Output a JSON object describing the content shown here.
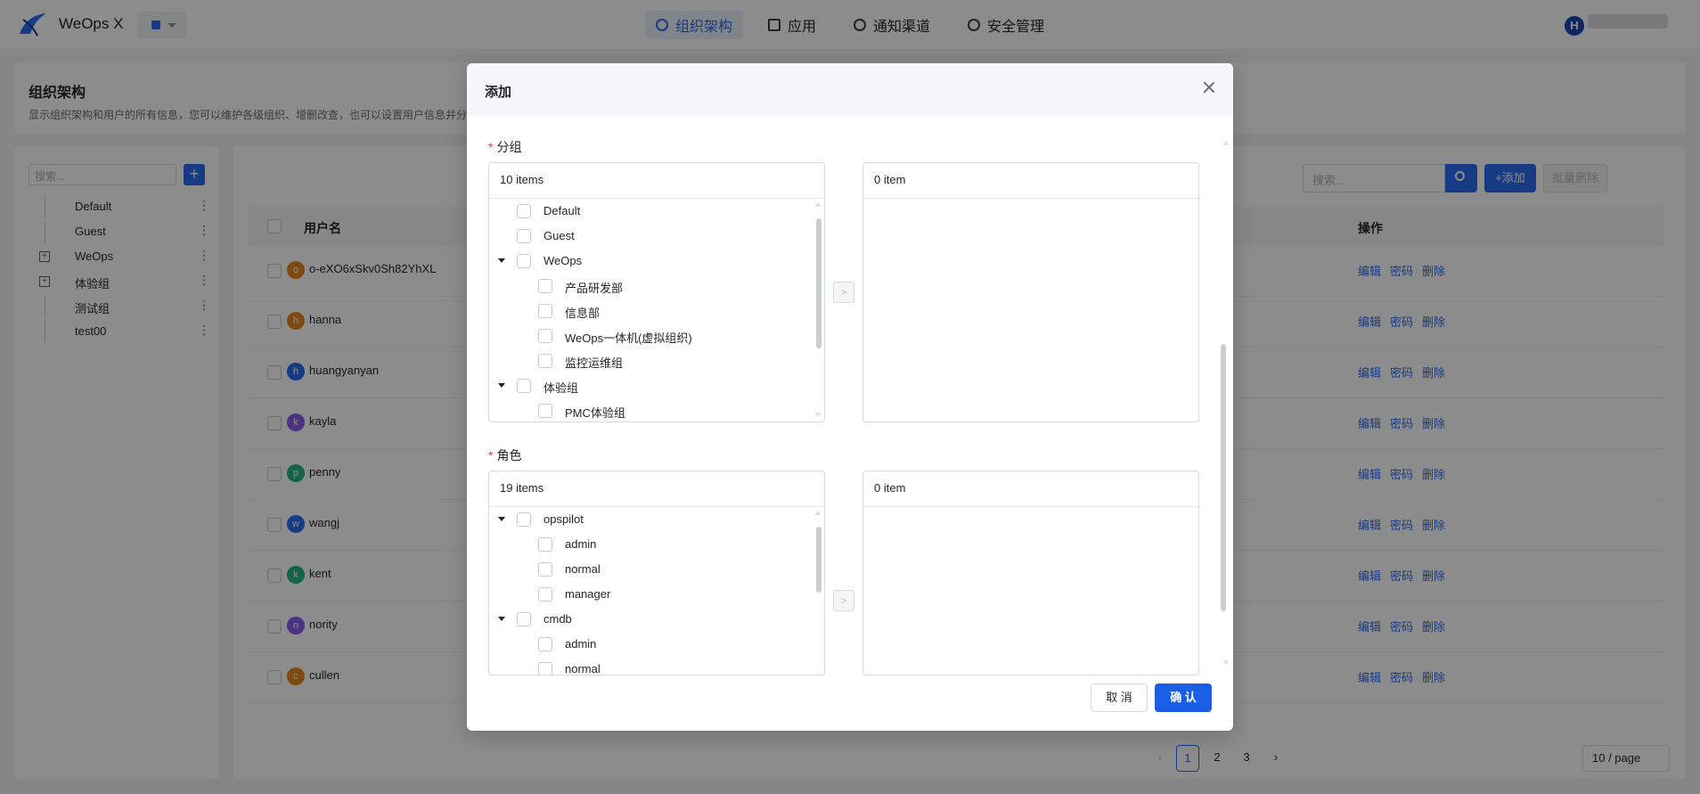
{
  "app": {
    "title": "WeOps X",
    "user_initial": "H"
  },
  "nav": [
    {
      "label": "组织架构",
      "icon": "org-icon",
      "active": true
    },
    {
      "label": "应用",
      "icon": "apps-icon",
      "active": false
    },
    {
      "label": "通知渠道",
      "icon": "share-icon",
      "active": false
    },
    {
      "label": "安全管理",
      "icon": "gear-icon",
      "active": false
    }
  ],
  "page": {
    "title": "组织架构",
    "description": "显示组织架构和用户的所有信息，您可以维护各级组织、增删改查，也可以设置用户信息并分"
  },
  "sidebar": {
    "search_placeholder": "搜索...",
    "items": [
      {
        "label": "Default",
        "expandable": false
      },
      {
        "label": "Guest",
        "expandable": false
      },
      {
        "label": "WeOps",
        "expandable": true
      },
      {
        "label": "体验组",
        "expandable": true
      },
      {
        "label": "测试组",
        "expandable": false
      },
      {
        "label": "test00",
        "expandable": false
      }
    ]
  },
  "toolbar": {
    "search_placeholder": "搜索...",
    "add_label": "+添加",
    "bulk_delete_label": "批量删除"
  },
  "table": {
    "columns": {
      "username": "用户名",
      "actions": "操作"
    },
    "action_labels": {
      "edit": "编辑",
      "password": "密码",
      "delete": "删除"
    },
    "rows": [
      {
        "initial": "o",
        "name": "o-eXO6xSkv0Sh82YhXL",
        "color": "#e8871e"
      },
      {
        "initial": "h",
        "name": "hanna",
        "color": "#e8871e"
      },
      {
        "initial": "h",
        "name": "huangyanyan",
        "color": "#2b6bf3"
      },
      {
        "initial": "k",
        "name": "kayla",
        "color": "#8a5cf0"
      },
      {
        "initial": "p",
        "name": "penny",
        "color": "#1fb58a"
      },
      {
        "initial": "w",
        "name": "wangj",
        "color": "#2b6bf3"
      },
      {
        "initial": "k",
        "name": "kent",
        "color": "#1fb58a"
      },
      {
        "initial": "n",
        "name": "nority",
        "color": "#8a5cf0"
      },
      {
        "initial": "c",
        "name": "cullen",
        "color": "#e8871e"
      }
    ]
  },
  "pagination": {
    "pages": [
      "1",
      "2",
      "3"
    ],
    "current": "1",
    "page_size": "10 / page",
    "prev": "‹",
    "next": "›"
  },
  "modal": {
    "title": "添加",
    "cancel_label": "取 消",
    "ok_label": "确 认",
    "move_label": ">",
    "groups": {
      "label": "分组",
      "left_count": "10 items",
      "right_count": "0 item",
      "items": [
        {
          "label": "Default",
          "level": 0,
          "expanded": null
        },
        {
          "label": "Guest",
          "level": 0,
          "expanded": null
        },
        {
          "label": "WeOps",
          "level": 0,
          "expanded": true
        },
        {
          "label": "产品研发部",
          "level": 1,
          "expanded": null
        },
        {
          "label": "信息部",
          "level": 1,
          "expanded": null
        },
        {
          "label": "WeOps一体机(虚拟组织)",
          "level": 1,
          "expanded": null
        },
        {
          "label": "监控运维组",
          "level": 1,
          "expanded": null
        },
        {
          "label": "体验组",
          "level": 0,
          "expanded": true
        },
        {
          "label": "PMC体验组",
          "level": 1,
          "expanded": null
        }
      ]
    },
    "roles": {
      "label": "角色",
      "left_count": "19 items",
      "right_count": "0 item",
      "items": [
        {
          "label": "opspilot",
          "level": 0,
          "expanded": true
        },
        {
          "label": "admin",
          "level": 1,
          "expanded": null
        },
        {
          "label": "normal",
          "level": 1,
          "expanded": null
        },
        {
          "label": "manager",
          "level": 1,
          "expanded": null
        },
        {
          "label": "cmdb",
          "level": 0,
          "expanded": true
        },
        {
          "label": "admin",
          "level": 1,
          "expanded": null
        },
        {
          "label": "normal",
          "level": 1,
          "expanded": null
        }
      ]
    }
  }
}
